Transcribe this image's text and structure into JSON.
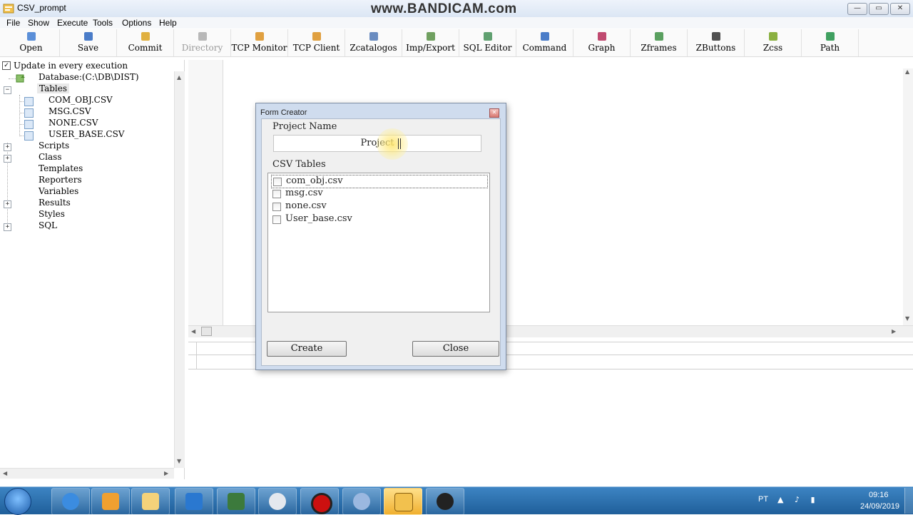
{
  "window": {
    "title": "CSV_prompt",
    "watermark": "www.BANDICAM.com",
    "min_glyph": "—",
    "max_glyph": "▭",
    "close_glyph": "✕"
  },
  "menu": [
    "File",
    "Show",
    "Execute",
    "Tools",
    "Options",
    "Help"
  ],
  "toolbar": [
    {
      "label": "Open",
      "icon": "open-icon",
      "color": "#5b8fd8"
    },
    {
      "label": "Save",
      "icon": "save-icon",
      "color": "#4a7cc8"
    },
    {
      "label": "Commit",
      "icon": "commit-icon",
      "color": "#e0b040"
    },
    {
      "label": "Directory",
      "icon": "directory-icon",
      "color": "#b8b8b8",
      "disabled": true
    },
    {
      "label": "TCP Monitor",
      "icon": "tcp-monitor-icon",
      "color": "#e0a040"
    },
    {
      "label": "TCP Client",
      "icon": "tcp-client-icon",
      "color": "#e0a040"
    },
    {
      "label": "Zcatalogos",
      "icon": "zcatalogos-icon",
      "color": "#6a8cc0"
    },
    {
      "label": "Imp/Export",
      "icon": "imp-export-icon",
      "color": "#70a060"
    },
    {
      "label": "SQL Editor",
      "icon": "sql-editor-icon",
      "color": "#60a070"
    },
    {
      "label": "Command",
      "icon": "command-icon",
      "color": "#4a7cc8"
    },
    {
      "label": "Graph",
      "icon": "graph-icon",
      "color": "#c04a70"
    },
    {
      "label": "Zframes",
      "icon": "zframes-icon",
      "color": "#5aa060"
    },
    {
      "label": "ZButtons",
      "icon": "zbuttons-icon",
      "color": "#505050"
    },
    {
      "label": "Zcss",
      "icon": "zcss-icon",
      "color": "#8ab040"
    },
    {
      "label": "Path",
      "icon": "path-icon",
      "color": "#40a060"
    }
  ],
  "tree": {
    "checkbox_label": "Update in every execution",
    "database": "Database:(C:\\DB\\DIST)",
    "tables_label": "Tables",
    "tables": [
      "COM_OBJ.CSV",
      "MSG.CSV",
      "NONE.CSV",
      "USER_BASE.CSV"
    ],
    "nodes": [
      "Scripts",
      "Class",
      "Templates",
      "Reporters",
      "Variables",
      "Results",
      "Styles",
      "SQL"
    ]
  },
  "dialog": {
    "title": "Form Creator",
    "close_glyph": "✕",
    "project_name_label": "Project Name",
    "project_name_value": "Project",
    "csv_tables_label": "CSV Tables",
    "csv_tables": [
      "com_obj.csv",
      "msg.csv",
      "none.csv",
      "User_base.csv"
    ],
    "create_label": "Create",
    "close_label": "Close"
  },
  "taskbar": {
    "language": "PT",
    "time": "09:16",
    "date": "24/09/2019"
  }
}
